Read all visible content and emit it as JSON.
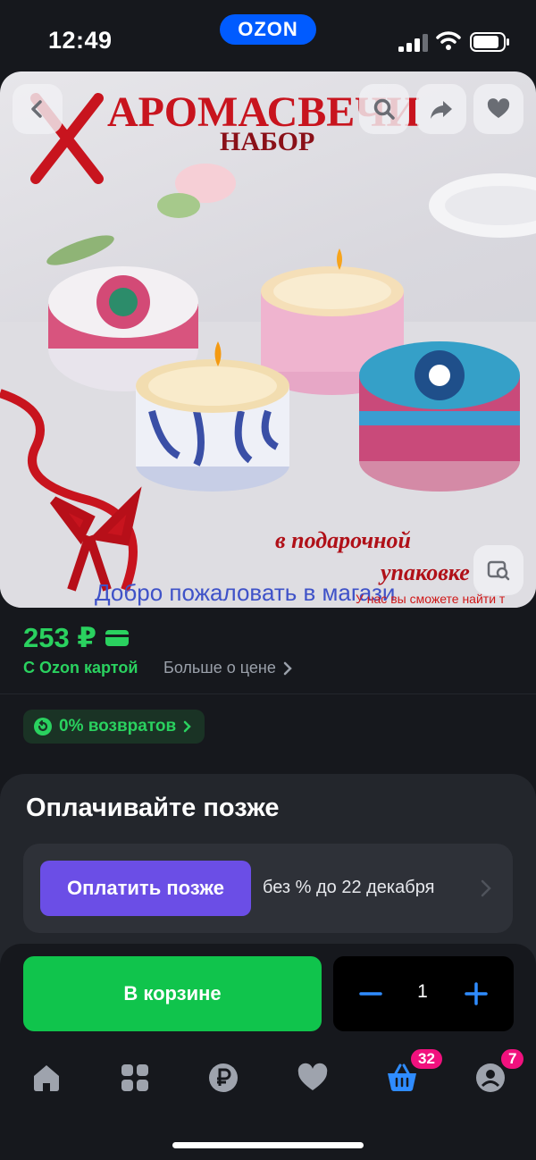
{
  "status_bar": {
    "time": "12:49",
    "brand": "OZON"
  },
  "product_image": {
    "title_text": "АРОМАСВЕЧИ",
    "subtitle_text": "НАБОР",
    "gift_text_1": "в подарочной",
    "gift_text_2": "упаковке",
    "welcome_text": "Добро пожаловать в магази",
    "note_text": "У нас вы сможете найти т"
  },
  "price": {
    "amount": "253 ₽",
    "card_label": "С Ozon картой",
    "more_label": "Больше о цене"
  },
  "returns": {
    "label": "0% возвратов"
  },
  "pay_later": {
    "title": "Оплачивайте позже",
    "button_label": "Оплатить позже",
    "terms": "без % до 22 декабря"
  },
  "cart": {
    "button_label": "В корзине",
    "quantity": "1"
  },
  "tabbar": {
    "items": [
      "home-icon",
      "catalog-icon",
      "ruble-icon",
      "favorites-icon",
      "cart-icon",
      "profile-icon"
    ],
    "cart_badge": "32",
    "profile_badge": "7"
  },
  "colors": {
    "accent_green": "#2ad15f",
    "button_green": "#10c44c",
    "purple": "#6b4ee6",
    "blue": "#005bff",
    "badge_pink": "#f1117e"
  }
}
